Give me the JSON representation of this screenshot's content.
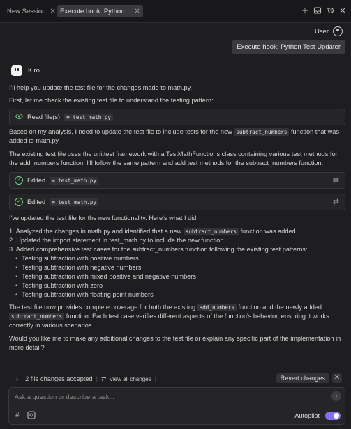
{
  "tabs": [
    {
      "label": "New Session",
      "close": "✕"
    },
    {
      "label": "Execute hook: Python...",
      "close": "✕"
    }
  ],
  "toolbar_icons": [
    "plus-icon",
    "inbox-icon",
    "history-icon",
    "close-icon"
  ],
  "user": {
    "name": "User"
  },
  "user_message": "Execute hook: Python Test Updater",
  "assistant": {
    "name": "Kiro"
  },
  "p1": "I'll help you update the test file for the changes made to math.py.",
  "p2": "First, let me check the existing test file to understand the testing pattern:",
  "read_box": {
    "label": "Read file(s)",
    "file": "test_math.py"
  },
  "p3a": "Based on my analysis, I need to update the test file to include tests for the new",
  "p3code": "subtract_numbers",
  "p3b": "function that was",
  "p3c": "added to math.py.",
  "p4": "The existing test file uses the unittest framework with a TestMathFunctions class containing various test methods for the add_numbers function. I'll follow the same pattern and add test methods for the subtract_numbers function.",
  "edited_boxes": [
    {
      "label": "Edited",
      "file": "test_math.py"
    },
    {
      "label": "Edited",
      "file": "test_math.py"
    }
  ],
  "p5": "I've updated the test file for the new functionality. Here's what I did:",
  "list": {
    "item1a": "1. Analyzed the changes in math.py and identified that a new",
    "item1code": "subtract_numbers",
    "item1b": "function was added",
    "item2": "2. Updated the import statement in test_math.py to include the new function",
    "item3": "3. Added comprehensive test cases for the subtract_numbers function following the existing test patterns:",
    "subitems": [
      "Testing subtraction with positive numbers",
      "Testing subtraction with negative numbers",
      "Testing subtraction with mixed positive and negative numbers",
      "Testing subtraction with zero",
      "Testing subtraction with floating point numbers"
    ]
  },
  "p6a": "The test file now provides complete coverage for both the existing",
  "p6code1": "add_numbers",
  "p6b": "function and the newly added",
  "p6code2": "subtract_numbers",
  "p6c": "function. Each test case verifies different aspects of the function's behavior, ensuring it works",
  "p6d": "correctly in various scenarios.",
  "p7": "Would you like me to make any additional changes to the test file or explain any specific part of the implementation in more detail?",
  "changes_bar": {
    "count": "2 file changes accepted",
    "view_all": "View all changes",
    "revert": "Revert changes"
  },
  "composer": {
    "placeholder": "Ask a question or describe a task...",
    "mode": "Autopilot"
  },
  "colors": {
    "accent": "#8a6ef0",
    "success": "#7ad089"
  }
}
